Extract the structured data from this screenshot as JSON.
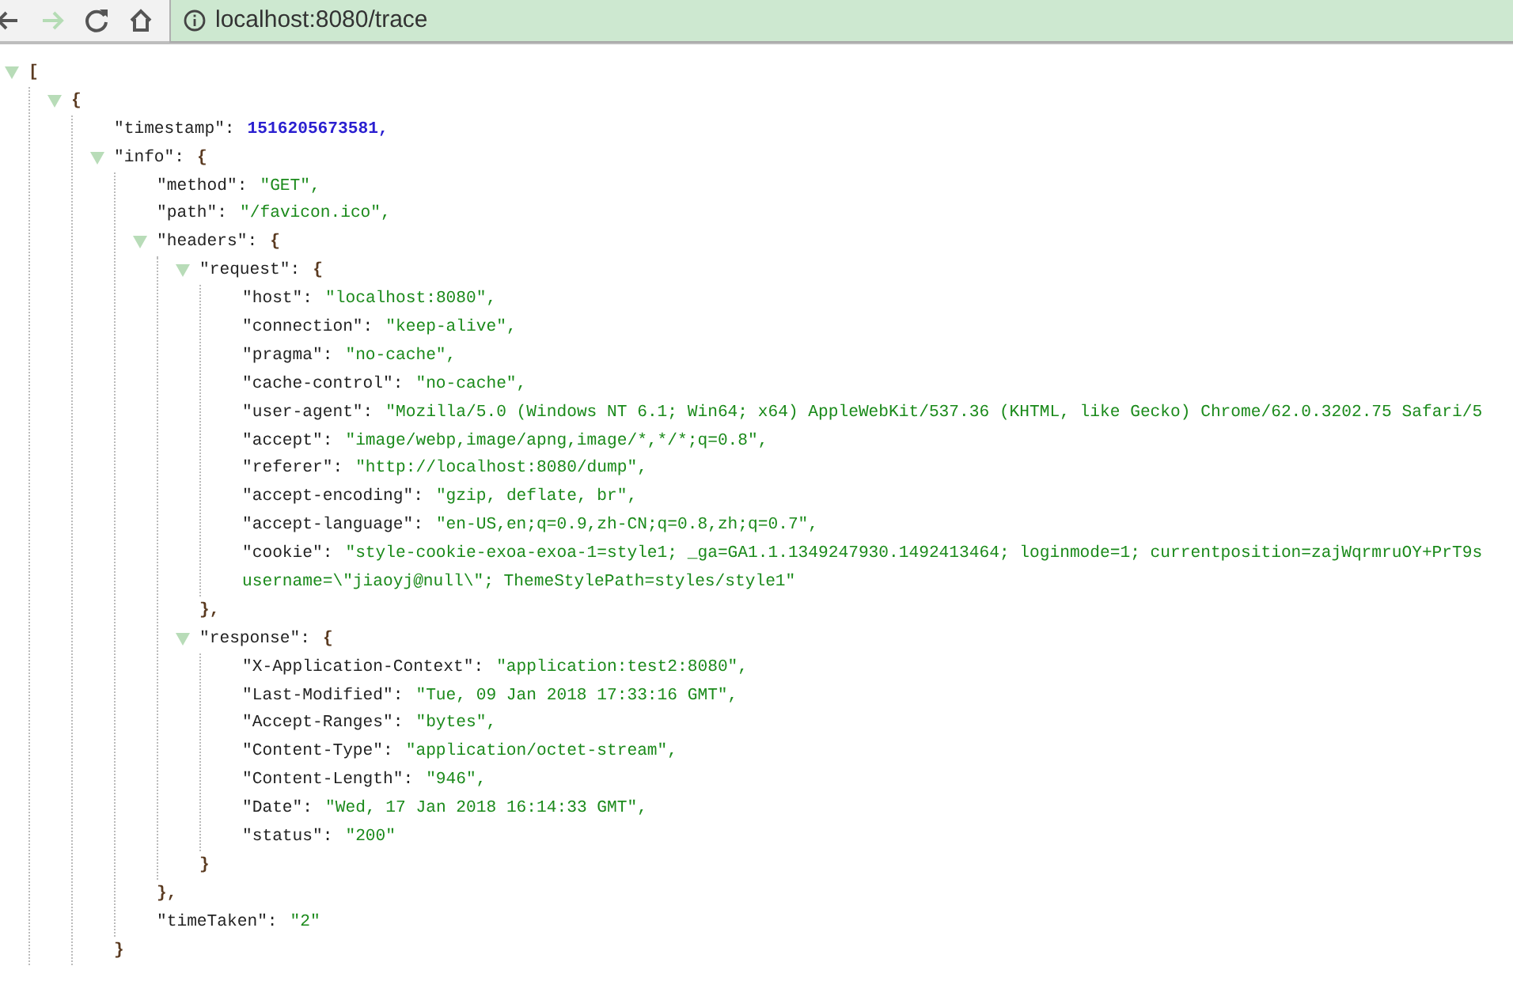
{
  "toolbar": {
    "nav": [
      {
        "kind": "back",
        "disabled": false
      },
      {
        "kind": "forward",
        "disabled": true
      },
      {
        "kind": "reload",
        "disabled": false
      },
      {
        "kind": "home",
        "disabled": false
      }
    ],
    "address": "localhost:8080/trace"
  },
  "tree": [
    {
      "kind": "array",
      "open": "[",
      "expanded": true,
      "children": [
        {
          "kind": "object",
          "open": "{",
          "expanded": true,
          "children": [
            {
              "kind": "number",
              "key": "\"timestamp\":",
              "value": "1516205673581,"
            },
            {
              "kind": "object",
              "key": "\"info\":",
              "open": "{",
              "close": "}",
              "expanded": true,
              "children": [
                {
                  "kind": "string",
                  "key": "\"method\":",
                  "value": "\"GET\","
                },
                {
                  "kind": "string",
                  "key": "\"path\":",
                  "value": "\"/favicon.ico\","
                },
                {
                  "kind": "object",
                  "key": "\"headers\":",
                  "open": "{",
                  "close": "},",
                  "expanded": true,
                  "children": [
                    {
                      "kind": "object",
                      "key": "\"request\":",
                      "open": "{",
                      "close": "},",
                      "expanded": true,
                      "children": [
                        {
                          "kind": "string",
                          "key": "\"host\":",
                          "value": "\"localhost:8080\","
                        },
                        {
                          "kind": "string",
                          "key": "\"connection\":",
                          "value": "\"keep-alive\","
                        },
                        {
                          "kind": "string",
                          "key": "\"pragma\":",
                          "value": "\"no-cache\","
                        },
                        {
                          "kind": "string",
                          "key": "\"cache-control\":",
                          "value": "\"no-cache\","
                        },
                        {
                          "kind": "string",
                          "key": "\"user-agent\":",
                          "value": "\"Mozilla/5.0 (Windows NT 6.1; Win64; x64) AppleWebKit/537.36 (KHTML, like Gecko) Chrome/62.0.3202.75 Safari/5"
                        },
                        {
                          "kind": "string",
                          "key": "\"accept\":",
                          "value": "\"image/webp,image/apng,image/*,*/*;q=0.8\","
                        },
                        {
                          "kind": "string",
                          "key": "\"referer\":",
                          "value": "\"http://localhost:8080/dump\","
                        },
                        {
                          "kind": "string",
                          "key": "\"accept-encoding\":",
                          "value": "\"gzip, deflate, br\","
                        },
                        {
                          "kind": "string",
                          "key": "\"accept-language\":",
                          "value": "\"en-US,en;q=0.9,zh-CN;q=0.8,zh;q=0.7\","
                        },
                        {
                          "kind": "string",
                          "key": "\"cookie\":",
                          "value": "\"style-cookie-exoa-exoa-1=style1; _ga=GA1.1.1349247930.1492413464; loginmode=1; currentposition=zajWqrmruOY+PrT9s",
                          "continuation": "username=\\\"jiaoyj@null\\\"; ThemeStylePath=styles/style1\""
                        }
                      ]
                    },
                    {
                      "kind": "object",
                      "key": "\"response\":",
                      "open": "{",
                      "close": "}",
                      "expanded": true,
                      "children": [
                        {
                          "kind": "string",
                          "key": "\"X-Application-Context\":",
                          "value": "\"application:test2:8080\","
                        },
                        {
                          "kind": "string",
                          "key": "\"Last-Modified\":",
                          "value": "\"Tue, 09 Jan 2018 17:33:16 GMT\","
                        },
                        {
                          "kind": "string",
                          "key": "\"Accept-Ranges\":",
                          "value": "\"bytes\","
                        },
                        {
                          "kind": "string",
                          "key": "\"Content-Type\":",
                          "value": "\"application/octet-stream\","
                        },
                        {
                          "kind": "string",
                          "key": "\"Content-Length\":",
                          "value": "\"946\","
                        },
                        {
                          "kind": "string",
                          "key": "\"Date\":",
                          "value": "\"Wed, 17 Jan 2018 16:14:33 GMT\","
                        },
                        {
                          "kind": "string",
                          "key": "\"status\":",
                          "value": "\"200\""
                        }
                      ]
                    }
                  ]
                },
                {
                  "kind": "string",
                  "key": "\"timeTaken\":",
                  "value": "\"2\""
                }
              ]
            }
          ]
        }
      ]
    }
  ]
}
